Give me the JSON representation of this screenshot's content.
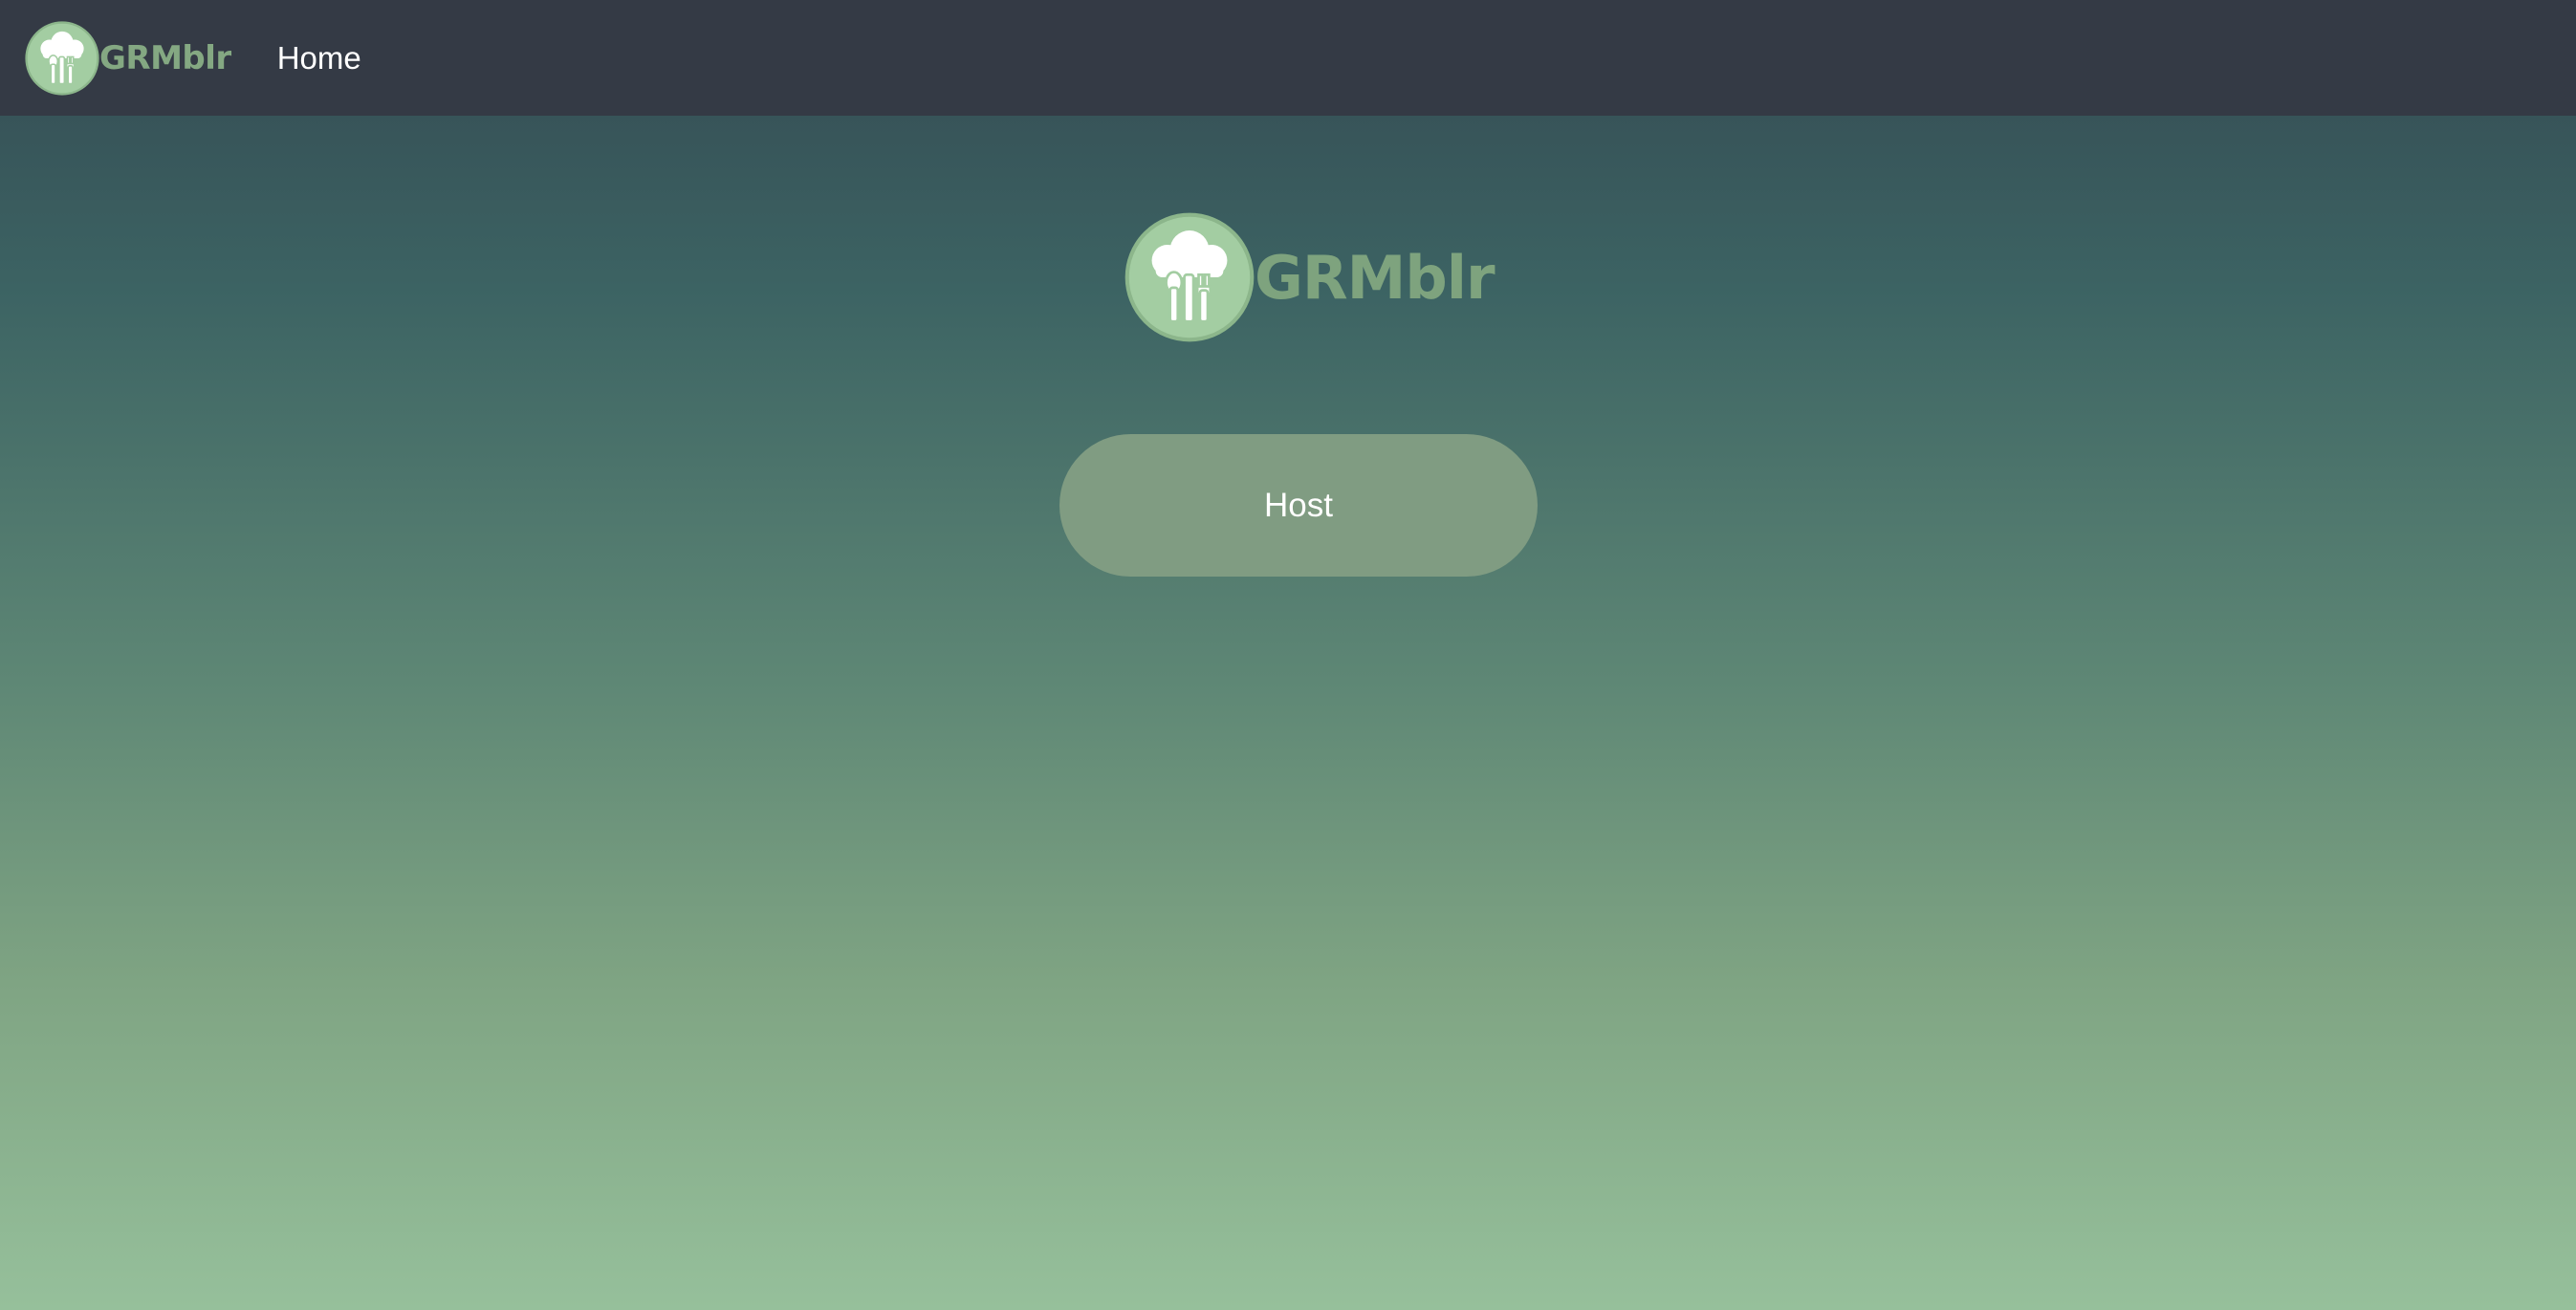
{
  "navbar": {
    "brand_name": "GRMblr",
    "logo_icon": "chef-hat-utensils-icon",
    "links": [
      {
        "label": "Home"
      }
    ]
  },
  "hero": {
    "brand_name": "GRMblr",
    "logo_icon": "chef-hat-utensils-icon"
  },
  "actions": {
    "host_label": "Host"
  },
  "colors": {
    "navbar_bg": "#343a45",
    "brand_text": "#84a882",
    "logo_circle": "#a3cda2",
    "button_bg": "#809c82",
    "gradient_top": "#344a52",
    "gradient_bottom": "#96c09b"
  }
}
